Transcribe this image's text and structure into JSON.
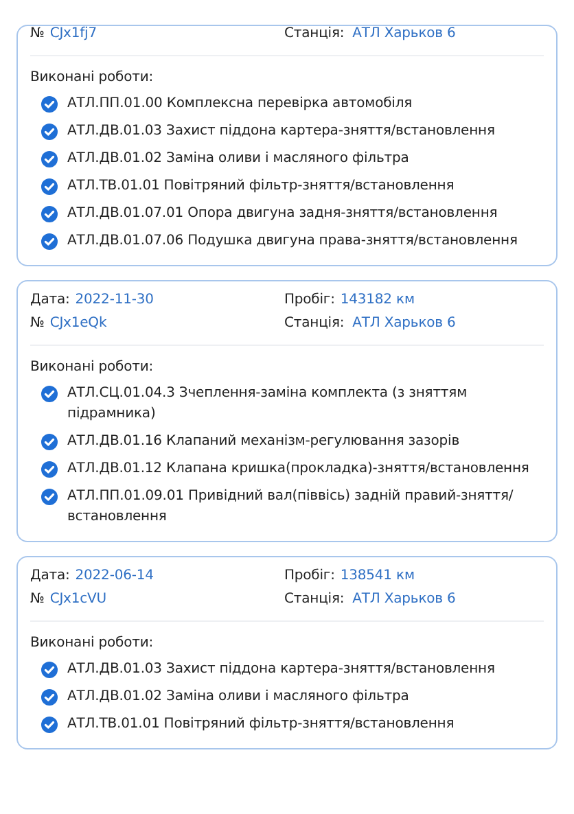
{
  "records": [
    {
      "number": "CJx1fj7",
      "station": "АТЛ Харьков 6",
      "works_label": "Виконані роботи:",
      "works": [
        "АТЛ.ПП.01.00 Комплексна перевірка автомобіля",
        "АТЛ.ДВ.01.03 Захист піддона картера-зняття/встановлення",
        "АТЛ.ДВ.01.02 Заміна оливи і масляного фільтра",
        "АТЛ.ТВ.01.01 Повітряний фільтр-зняття/встановлення",
        "АТЛ.ДВ.01.07.01 Опора двигуна задня-зняття/встановлення",
        "АТЛ.ДВ.01.07.06 Подушка двигуна права-зняття/встановлення"
      ],
      "number_label": "№",
      "station_label": "Станція:"
    },
    {
      "date_label": "Дата:",
      "date": "2022-11-30",
      "mileage_label": "Пробіг:",
      "mileage": "143182 км",
      "number_label": "№",
      "number": "CJx1eQk",
      "station_label": "Станція:",
      "station": "АТЛ Харьков 6",
      "works_label": "Виконані роботи:",
      "works": [
        "АТЛ.СЦ.01.04.3 Зчеплення-заміна комплекта (з зняттям підрамника)",
        "АТЛ.ДВ.01.16 Клапаний механізм-регулювання зазорів",
        "АТЛ.ДВ.01.12 Клапана кришка(прокладка)-зняття/встановлення",
        "АТЛ.ПП.01.09.01 Привідний вал(піввісь) задній правий-зняття/встановлення"
      ]
    },
    {
      "date_label": "Дата:",
      "date": "2022-06-14",
      "mileage_label": "Пробіг:",
      "mileage": "138541 км",
      "number_label": "№",
      "number": "CJx1cVU",
      "station_label": "Станція:",
      "station": "АТЛ Харьков 6",
      "works_label": "Виконані роботи:",
      "works": [
        "АТЛ.ДВ.01.03 Захист піддона картера-зняття/встановлення",
        "АТЛ.ДВ.01.02 Заміна оливи і масляного фільтра",
        "АТЛ.ТВ.01.01 Повітряний фільтр-зняття/встановлення"
      ]
    }
  ]
}
